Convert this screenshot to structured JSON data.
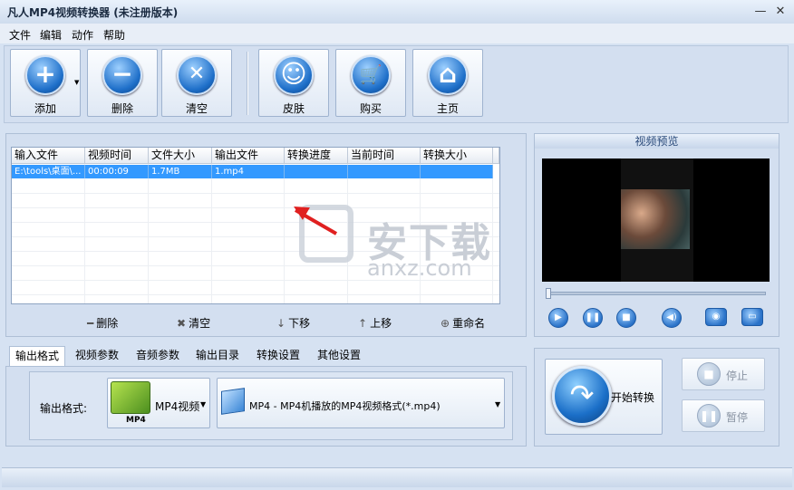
{
  "window": {
    "title": "凡人MP4视频转换器  (未注册版本)",
    "minimize": "—",
    "close": "✕"
  },
  "menu": [
    "文件",
    "编辑",
    "动作",
    "帮助"
  ],
  "toolbar": [
    {
      "label": "添加",
      "icon": "plus-icon",
      "glyph": "+"
    },
    {
      "label": "删除",
      "icon": "minus-icon",
      "glyph": "−"
    },
    {
      "label": "清空",
      "icon": "x-icon",
      "glyph": "✕"
    },
    {
      "label": "皮肤",
      "icon": "smiley-icon",
      "glyph": "☺"
    },
    {
      "label": "购买",
      "icon": "cart-icon",
      "glyph": "🛒"
    },
    {
      "label": "主页",
      "icon": "home-icon",
      "glyph": "⌂"
    }
  ],
  "file_table": {
    "columns": [
      "输入文件",
      "视频时间",
      "文件大小",
      "输出文件",
      "转换进度",
      "当前时间",
      "转换大小"
    ],
    "rows": [
      [
        "E:\\tools\\桌面\\...",
        "00:00:09",
        "1.7MB",
        "1.mp4",
        "",
        "",
        ""
      ]
    ]
  },
  "list_actions": [
    {
      "label": "删除",
      "icon": "minus-icon",
      "glyph": "━"
    },
    {
      "label": "清空",
      "icon": "x-icon",
      "glyph": "✖"
    },
    {
      "label": "下移",
      "icon": "arrow-down-icon",
      "glyph": "↓"
    },
    {
      "label": "上移",
      "icon": "arrow-up-icon",
      "glyph": "↑"
    },
    {
      "label": "重命名",
      "icon": "rename-icon",
      "glyph": "⊕"
    }
  ],
  "preview": {
    "title": "视频预览"
  },
  "tabs": [
    "输出格式",
    "视频参数",
    "音频参数",
    "输出目录",
    "转换设置",
    "其他设置"
  ],
  "format": {
    "label": "输出格式:",
    "button_label": "MP4视频",
    "badge": "MP4",
    "profile": "MP4 - MP4机播放的MP4视频格式(*.mp4)"
  },
  "controls": {
    "start": "开始转换",
    "stop": "停止",
    "pause": "暂停"
  },
  "watermark": {
    "text": "安下载",
    "sub": "anxz.com"
  },
  "colors": {
    "selection": "#3399ff",
    "accent": "#1e6fc9"
  }
}
